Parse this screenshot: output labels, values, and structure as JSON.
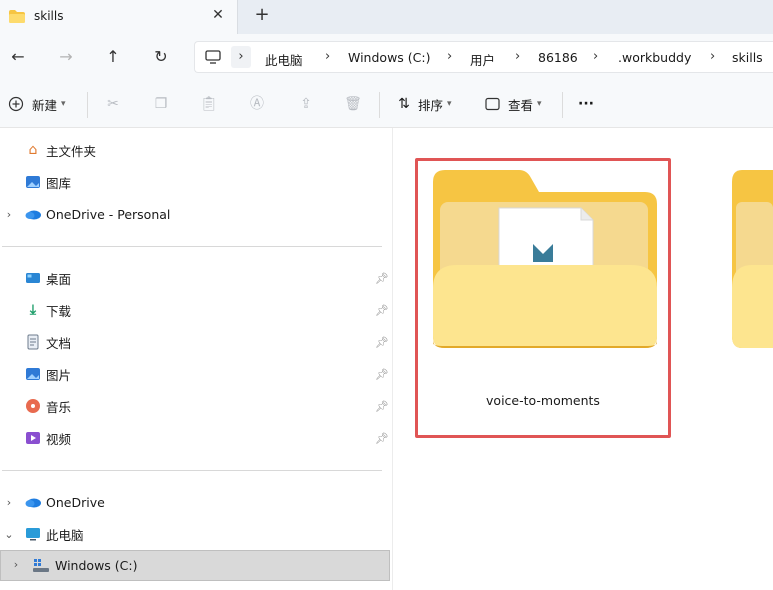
{
  "tab": {
    "title": "skills",
    "close": "✕",
    "new": "+"
  },
  "nav": {
    "back": "←",
    "forward": "→",
    "up": "↑",
    "refresh": "↻"
  },
  "address": {
    "crumbs": [
      "此电脑",
      "Windows (C:)",
      "用户",
      "86186",
      ".workbuddy",
      "skills"
    ],
    "separator": "›"
  },
  "toolbar": {
    "new_label": "新建",
    "sort_label": "排序",
    "view_label": "查看",
    "more_label": "···"
  },
  "sidebar": {
    "quick": [
      {
        "label": "主文件夹",
        "icon": "home-icon"
      },
      {
        "label": "图库",
        "icon": "gallery-icon"
      },
      {
        "label": "OneDrive - Personal",
        "icon": "cloud-icon"
      }
    ],
    "pinned": [
      {
        "label": "桌面",
        "icon": "desktop-icon"
      },
      {
        "label": "下载",
        "icon": "download-icon"
      },
      {
        "label": "文档",
        "icon": "document-icon"
      },
      {
        "label": "图片",
        "icon": "pictures-icon"
      },
      {
        "label": "音乐",
        "icon": "music-icon"
      },
      {
        "label": "视频",
        "icon": "video-icon"
      }
    ],
    "tree": [
      {
        "label": "OneDrive",
        "icon": "cloud-icon"
      },
      {
        "label": "此电脑",
        "icon": "pc-icon"
      },
      {
        "label": "Windows (C:)",
        "icon": "drive-icon"
      }
    ]
  },
  "content": {
    "folders": [
      {
        "name": "voice-to-moments",
        "selected": true
      }
    ]
  },
  "colors": {
    "highlight": "#e05555",
    "folder": "#f6c543",
    "folder_light": "#fde58f"
  }
}
